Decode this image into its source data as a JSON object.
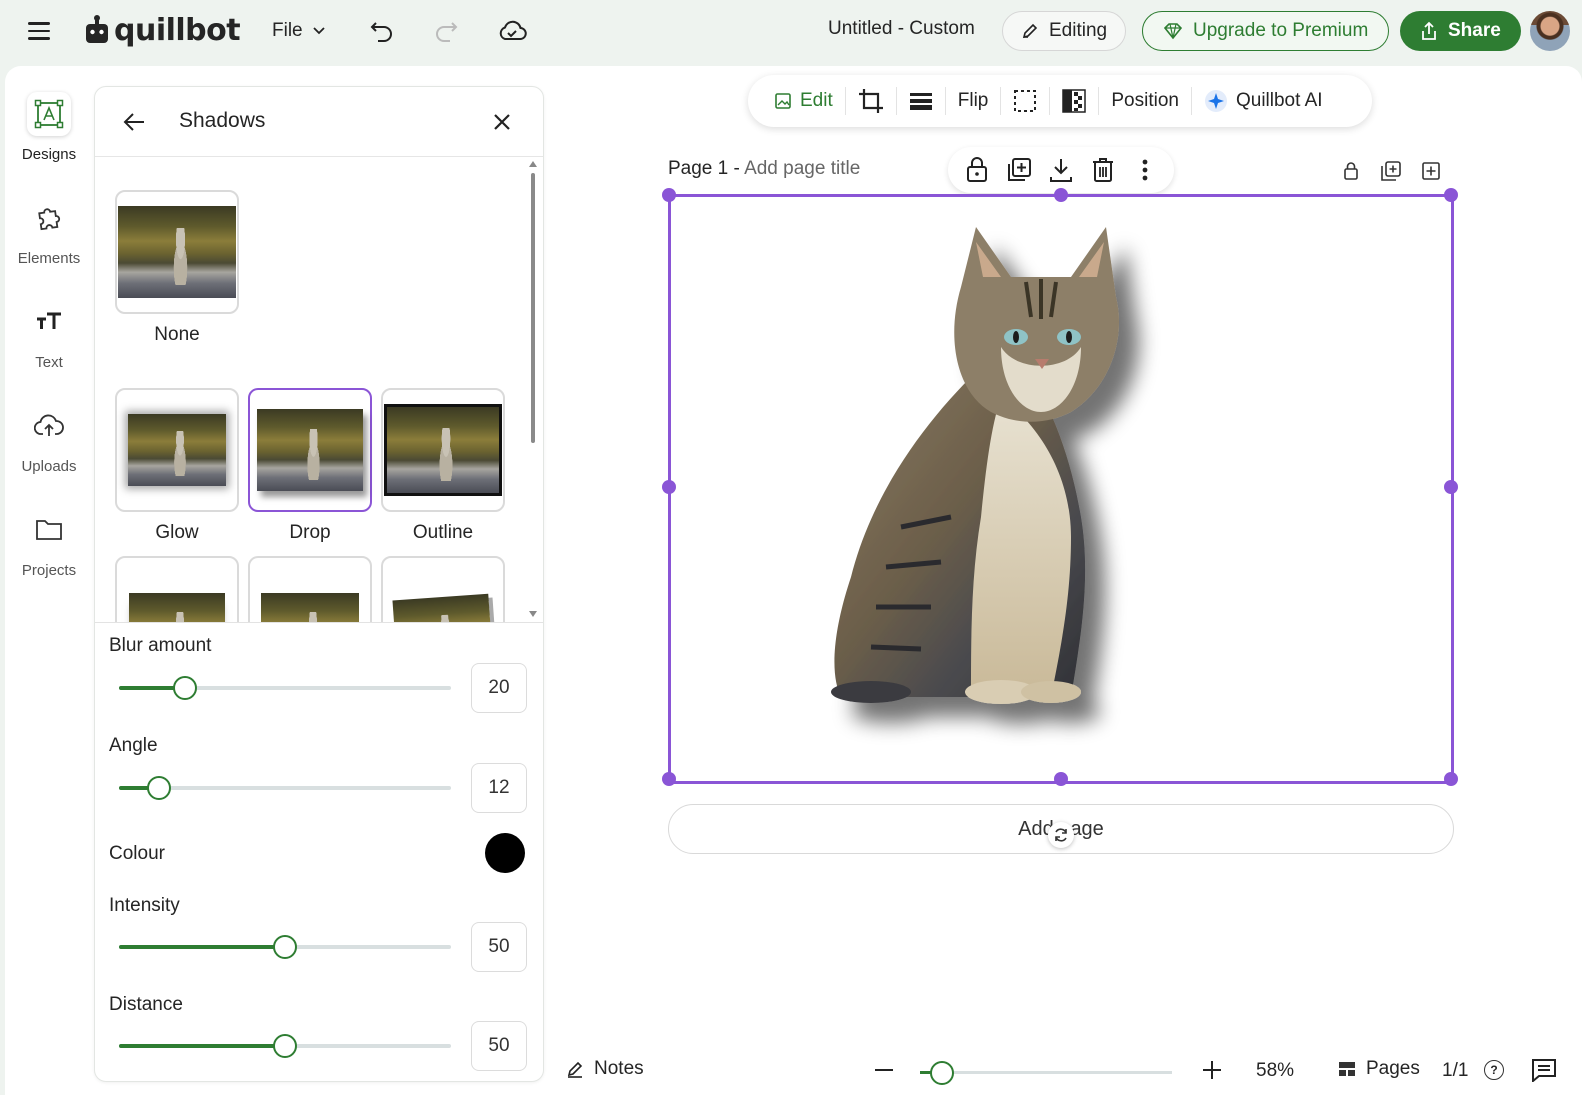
{
  "topbar": {
    "menu_icon": "hamburger-icon",
    "logo_text": "quillbot",
    "file_label": "File",
    "doc_title": "Untitled - Custom",
    "editing_label": "Editing",
    "upgrade_label": "Upgrade to Premium",
    "share_label": "Share"
  },
  "rail": {
    "items": [
      {
        "label": "Designs",
        "icon": "designs-icon"
      },
      {
        "label": "Elements",
        "icon": "elements-icon"
      },
      {
        "label": "Text",
        "icon": "text-icon"
      },
      {
        "label": "Uploads",
        "icon": "upload-cloud-icon"
      },
      {
        "label": "Projects",
        "icon": "folder-icon"
      }
    ]
  },
  "panel": {
    "title": "Shadows",
    "presets": [
      {
        "label": "None"
      },
      {
        "label": "Glow"
      },
      {
        "label": "Drop",
        "selected": true
      },
      {
        "label": "Outline"
      }
    ],
    "blur_label": "Blur amount",
    "blur_value": "20",
    "angle_label": "Angle",
    "angle_value": "12",
    "colour_label": "Colour",
    "colour_value": "#000000",
    "intensity_label": "Intensity",
    "intensity_value": "50",
    "distance_label": "Distance",
    "distance_value": "50"
  },
  "canvas_toolbar": {
    "edit_label": "Edit",
    "flip_label": "Flip",
    "position_label": "Position",
    "ai_label": "Quillbot AI"
  },
  "page": {
    "number_label": "Page 1 -",
    "title_placeholder": "Add page title",
    "add_page_label": "Add page"
  },
  "bottombar": {
    "notes_label": "Notes",
    "zoom_value": "58%",
    "pages_label": "Pages",
    "page_count": "1/1"
  },
  "colors": {
    "accent": "#2e7d32",
    "selection": "#8a55d6"
  }
}
